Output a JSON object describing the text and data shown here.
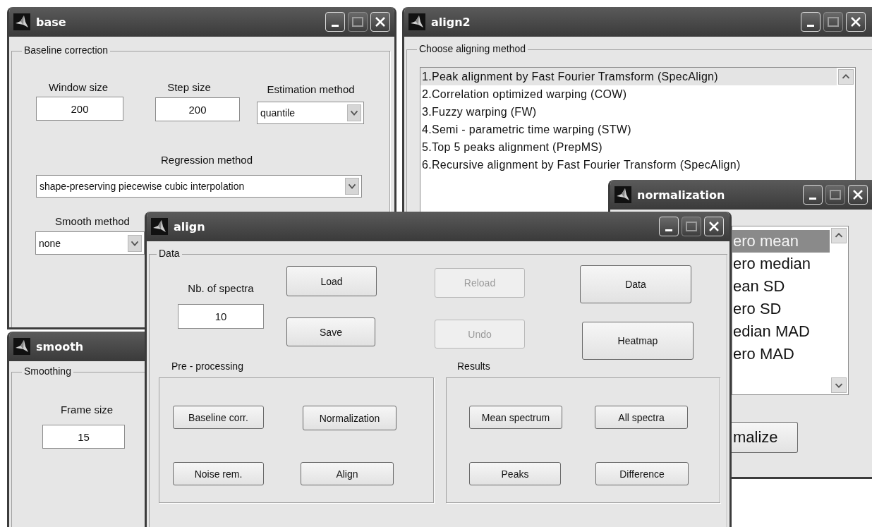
{
  "base_window": {
    "title": "base",
    "group": "Baseline correction",
    "window_size": {
      "label": "Window size",
      "value": "200"
    },
    "step_size": {
      "label": "Step size",
      "value": "200"
    },
    "estimation": {
      "label": "Estimation method",
      "value": "quantile"
    },
    "regression": {
      "label": "Regression method",
      "value": "shape-preserving piecewise cubic interpolation"
    },
    "smooth": {
      "label": "Smooth method",
      "value": "none"
    }
  },
  "align2_window": {
    "title": "align2",
    "group": "Choose aligning method",
    "methods": [
      {
        "label": "1.Peak alignment by Fast Fourier Tramsform (SpecAlign)",
        "selected": true
      },
      {
        "label": "2.Correlation optimized warping (COW)",
        "selected": false
      },
      {
        "label": "3.Fuzzy warping (FW)",
        "selected": false
      },
      {
        "label": "4.Semi - parametric time warping (STW)",
        "selected": false
      },
      {
        "label": "5.Top 5 peaks alignment (PrepMS)",
        "selected": false
      },
      {
        "label": "6.Recursive alignment by Fast Fourier Transform (SpecAlign)",
        "selected": false
      }
    ]
  },
  "smooth_window": {
    "title": "smooth",
    "group": "Smoothing",
    "frame_size": {
      "label": "Frame size",
      "value": "15"
    }
  },
  "normalization_window": {
    "title": "normalization",
    "methods": [
      {
        "label": "ero mean",
        "selected": true
      },
      {
        "label": "ero median",
        "selected": false
      },
      {
        "label": "ean SD",
        "selected": false
      },
      {
        "label": "ero SD",
        "selected": false
      },
      {
        "label": "edian MAD",
        "selected": false
      },
      {
        "label": "ero MAD",
        "selected": false
      }
    ],
    "button": "malize"
  },
  "align_window": {
    "title": "align",
    "data_group": {
      "legend": "Data",
      "spectra_label": "Nb. of spectra",
      "spectra_value": "10",
      "buttons": [
        {
          "label": "Load",
          "disabled": false
        },
        {
          "label": "Save",
          "disabled": false
        },
        {
          "label": "Reload",
          "disabled": true
        },
        {
          "label": "Undo",
          "disabled": true
        },
        {
          "label": "Data",
          "disabled": false
        },
        {
          "label": "Heatmap",
          "disabled": false
        }
      ]
    },
    "preprocessing": {
      "legend": "Pre - processing",
      "buttons": [
        {
          "label": "Baseline corr.",
          "disabled": false
        },
        {
          "label": "Normalization",
          "disabled": false
        },
        {
          "label": "Noise rem.",
          "disabled": false
        },
        {
          "label": "Align",
          "disabled": false
        }
      ]
    },
    "results": {
      "legend": "Results",
      "buttons": [
        {
          "label": "Mean spectrum",
          "disabled": false
        },
        {
          "label": "All spectra",
          "disabled": false
        },
        {
          "label": "Peaks",
          "disabled": false
        },
        {
          "label": "Difference",
          "disabled": false
        }
      ]
    }
  }
}
